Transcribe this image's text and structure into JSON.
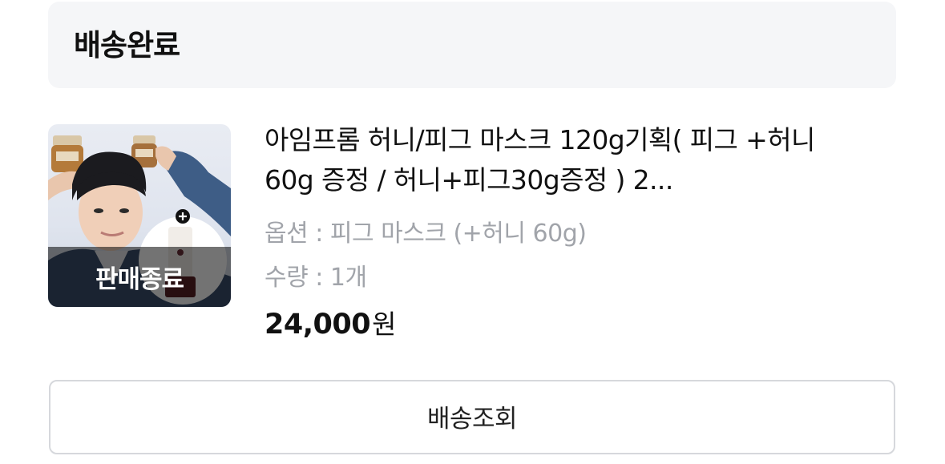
{
  "order_status": {
    "title": "배송완료"
  },
  "product": {
    "thumbnail": {
      "overlay_label": "판매종료",
      "image_description": "product-photo"
    },
    "name": "아임프롬 허니/피그 마스크 120g기획( 피그 +허니 60g 증정 / 허니+피그30g증정 ) 2...",
    "option": "옵션 : 피그 마스크 (+허니 60g)",
    "quantity": "수량 : 1개",
    "price_amount": "24,000",
    "price_unit": "원"
  },
  "actions": {
    "track_label": "배송조회"
  }
}
